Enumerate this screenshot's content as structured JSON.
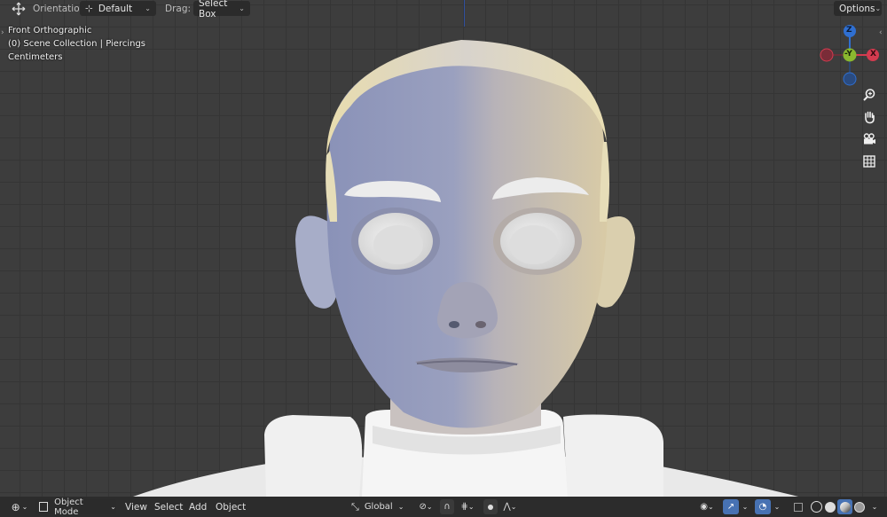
{
  "header": {
    "orientation_label": "Orientation:",
    "orientation_value": "Default",
    "drag_label": "Drag:",
    "drag_value": "Select Box",
    "options_label": "Options"
  },
  "viewport_info": {
    "view_name": "Front Orthographic",
    "collection": "(0) Scene Collection | Piercings",
    "units": "Centimeters"
  },
  "gizmo": {
    "z_label": "Z",
    "y_label": "-Y",
    "x_label": "X",
    "colors": {
      "z": "#2f6fd1",
      "y": "#8ab82f",
      "x": "#d43b4f",
      "neg": "#7a2c38",
      "neg_z": "#2a4b80"
    }
  },
  "nav_icons": [
    "zoom-icon",
    "hand-pan-icon",
    "camera-icon",
    "grid-perspective-icon"
  ],
  "footer": {
    "mode_label": "Object Mode",
    "menu_view": "View",
    "menu_select": "Select",
    "menu_add": "Add",
    "menu_object": "Object",
    "transform_orientation": "Global"
  },
  "colors": {
    "accent": "#4772b3",
    "bar": "#2c2c2c",
    "viewport_bg": "#3d3d3d"
  }
}
